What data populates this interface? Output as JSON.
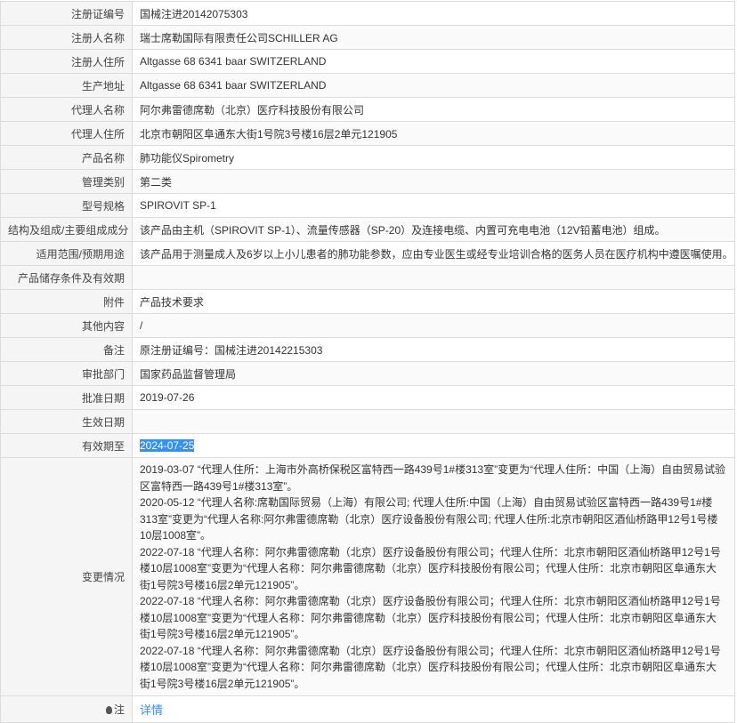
{
  "rows": [
    {
      "label": "注册证编号",
      "value": "国械注进20142075303"
    },
    {
      "label": "注册人名称",
      "value": "瑞士席勒国际有限责任公司SCHILLER AG"
    },
    {
      "label": "注册人住所",
      "value": "Altgasse 68 6341 baar SWITZERLAND"
    },
    {
      "label": "生产地址",
      "value": "Altgasse 68 6341 baar SWITZERLAND"
    },
    {
      "label": "代理人名称",
      "value": "阿尔弗雷德席勒（北京）医疗科技股份有限公司"
    },
    {
      "label": "代理人住所",
      "value": "北京市朝阳区阜通东大街1号院3号楼16层2单元121905"
    },
    {
      "label": "产品名称",
      "value": "肺功能仪Spirometry"
    },
    {
      "label": "管理类别",
      "value": "第二类"
    },
    {
      "label": "型号规格",
      "value": "SPIROVIT SP-1"
    },
    {
      "label": "结构及组成/主要组成成分",
      "value": "该产品由主机（SPIROVIT SP-1）、流量传感器（SP-20）及连接电缆、内置可充电电池（12V铅蓄电池）组成。"
    },
    {
      "label": "适用范围/预期用途",
      "value": "该产品用于测量成人及6岁以上小儿患者的肺功能参数，应由专业医生或经专业培训合格的医务人员在医疗机构中遵医嘱使用。"
    },
    {
      "label": "产品储存条件及有效期",
      "value": ""
    },
    {
      "label": "附件",
      "value": "产品技术要求"
    },
    {
      "label": "其他内容",
      "value": "/"
    },
    {
      "label": "备注",
      "value": "原注册证编号：国械注进20142215303"
    },
    {
      "label": "审批部门",
      "value": "国家药品监督管理局"
    },
    {
      "label": "批准日期",
      "value": "2019-07-26"
    },
    {
      "label": "生效日期",
      "value": ""
    },
    {
      "label": "有效期至",
      "value": "2024-07-25"
    }
  ],
  "changes": {
    "label": "变更情况",
    "entries": [
      "2019-03-07 “代理人住所：上海市外高桥保税区富特西一路439号1#楼313室”变更为“代理人住所：中国（上海）自由贸易试验区富特西一路439号1#楼313室”。",
      "2020-05-12 “代理人名称:席勒国际贸易（上海）有限公司; 代理人住所:中国（上海）自由贸易试验区富特西一路439号1#楼313室”变更为“代理人名称:阿尔弗雷德席勒（北京）医疗设备股份有限公司; 代理人住所:北京市朝阳区酒仙桥路甲12号1号楼10层1008室”。",
      "2022-07-18 “代理人名称：阿尔弗雷德席勒（北京）医疗设备股份有限公司；代理人住所：北京市朝阳区酒仙桥路甲12号1号楼10层1008室”变更为“代理人名称：阿尔弗雷德席勒（北京）医疗科技股份有限公司；代理人住所：北京市朝阳区阜通东大街1号院3号楼16层2单元121905”。",
      "2022-07-18 “代理人名称：阿尔弗雷德席勒（北京）医疗设备股份有限公司；代理人住所：北京市朝阳区酒仙桥路甲12号1号楼10层1008室”变更为“代理人名称：阿尔弗雷德席勒（北京）医疗科技股份有限公司；代理人住所：北京市朝阳区阜通东大街1号院3号楼16层2单元121905”。",
      "2022-07-18 “代理人名称：阿尔弗雷德席勒（北京）医疗设备股份有限公司；代理人住所：北京市朝阳区酒仙桥路甲12号1号楼10层1008室”变更为“代理人名称：阿尔弗雷德席勒（北京）医疗科技股份有限公司；代理人住所：北京市朝阳区阜通东大街1号院3号楼16层2单元121905”。"
    ]
  },
  "note": {
    "label": "注",
    "link": "详情"
  }
}
